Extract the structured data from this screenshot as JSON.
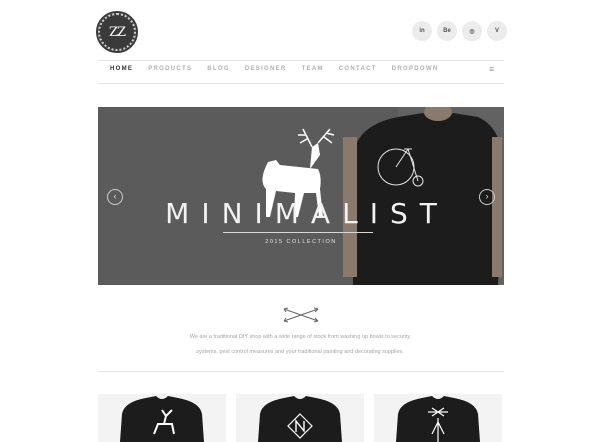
{
  "brand": {
    "logo_text": "ZZ"
  },
  "social": [
    {
      "icon": "linkedin-icon",
      "label": "in"
    },
    {
      "icon": "behance-icon",
      "label": "Be"
    },
    {
      "icon": "dribbble-icon",
      "label": "◎"
    },
    {
      "icon": "vimeo-icon",
      "label": "V"
    }
  ],
  "nav": {
    "items": [
      "HOME",
      "PRODUCTS",
      "BLOG",
      "DESIGNER",
      "TEAM",
      "CONTACT",
      "DROPDOWN"
    ],
    "menu_icon": "≡"
  },
  "hero": {
    "title": "MINIMALIST",
    "subtitle": "2015 COLLECTION",
    "prev": "‹",
    "next": "›"
  },
  "about": {
    "line1": "We are a traditional DIY shop with a wide range of stock from washing up bowls to security",
    "line2": "systems, pest control measures and your traditional painting and decorating supplies."
  },
  "colors": {
    "hero_bg": "#5b5b5b",
    "accent": "#333333"
  }
}
